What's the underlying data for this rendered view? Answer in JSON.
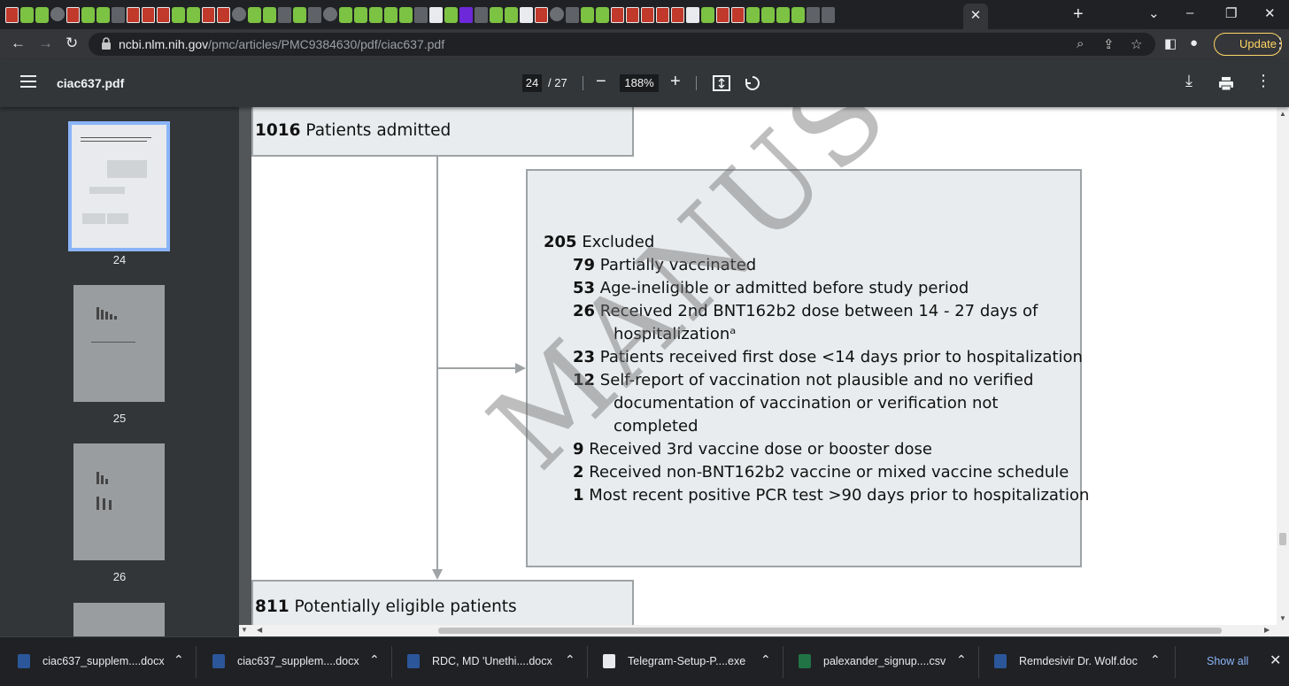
{
  "browser": {
    "active_tab_close": "✕",
    "new_tab": "+",
    "window_controls": [
      "⌄",
      "–",
      "❐",
      "✕"
    ]
  },
  "address_bar": {
    "url_host": "ncbi.nlm.nih.gov",
    "url_path": "/pmc/articles/PMC9384630/pdf/ciac637.pdf",
    "update_label": "Update"
  },
  "pdf_toolbar": {
    "title": "ciac637.pdf",
    "current_page": "24",
    "total_pages": "/ 27",
    "zoom": "188%"
  },
  "thumbnails": [
    {
      "label": "24",
      "selected": true
    },
    {
      "label": "25",
      "selected": false
    },
    {
      "label": "26",
      "selected": false
    }
  ],
  "flowchart": {
    "admitted": {
      "count": "1016",
      "text": "Patients admitted"
    },
    "excluded": {
      "count": "205",
      "text": "Excluded",
      "items": [
        {
          "count": "79",
          "lines": [
            "Partially vaccinated"
          ]
        },
        {
          "count": "53",
          "lines": [
            "Age-ineligible or admitted before study period"
          ]
        },
        {
          "count": "26",
          "lines": [
            "Received 2nd BNT162b2 dose between 14 - 27 days of",
            "hospitalizationᵃ"
          ]
        },
        {
          "count": "23",
          "lines": [
            "Patients received first dose <14 days prior to hospitalization"
          ]
        },
        {
          "count": "12",
          "lines": [
            "Self-report of vaccination not plausible and no verified",
            "documentation of vaccination or verification not",
            "completed"
          ]
        },
        {
          "count": "9",
          "lines": [
            "Received 3rd vaccine dose or booster dose"
          ]
        },
        {
          "count": "2",
          "lines": [
            "Received non-BNT162b2 vaccine or mixed vaccine schedule"
          ]
        },
        {
          "count": "1",
          "lines": [
            "Most recent positive PCR test >90 days prior to hospitalization"
          ]
        }
      ]
    },
    "eligible": {
      "count": "811",
      "text": "Potentially eligible patients"
    },
    "watermark": "MANUSCRIPT"
  },
  "downloads": {
    "items": [
      {
        "name": "ciac637_supplem....docx",
        "type": "word"
      },
      {
        "name": "ciac637_supplem....docx",
        "type": "word"
      },
      {
        "name": "RDC, MD 'Unethi....docx",
        "type": "word"
      },
      {
        "name": "Telegram-Setup-P....exe",
        "type": "exe"
      },
      {
        "name": "palexander_signup....csv",
        "type": "excel"
      },
      {
        "name": "Remdesivir Dr. Wolf.doc",
        "type": "word"
      }
    ],
    "show_all": "Show all"
  },
  "colors": {
    "accent_blue": "#8ab4f8",
    "update_yellow": "#fdd663",
    "box_fill": "#e8ecee",
    "box_border": "#9ea3a6"
  }
}
